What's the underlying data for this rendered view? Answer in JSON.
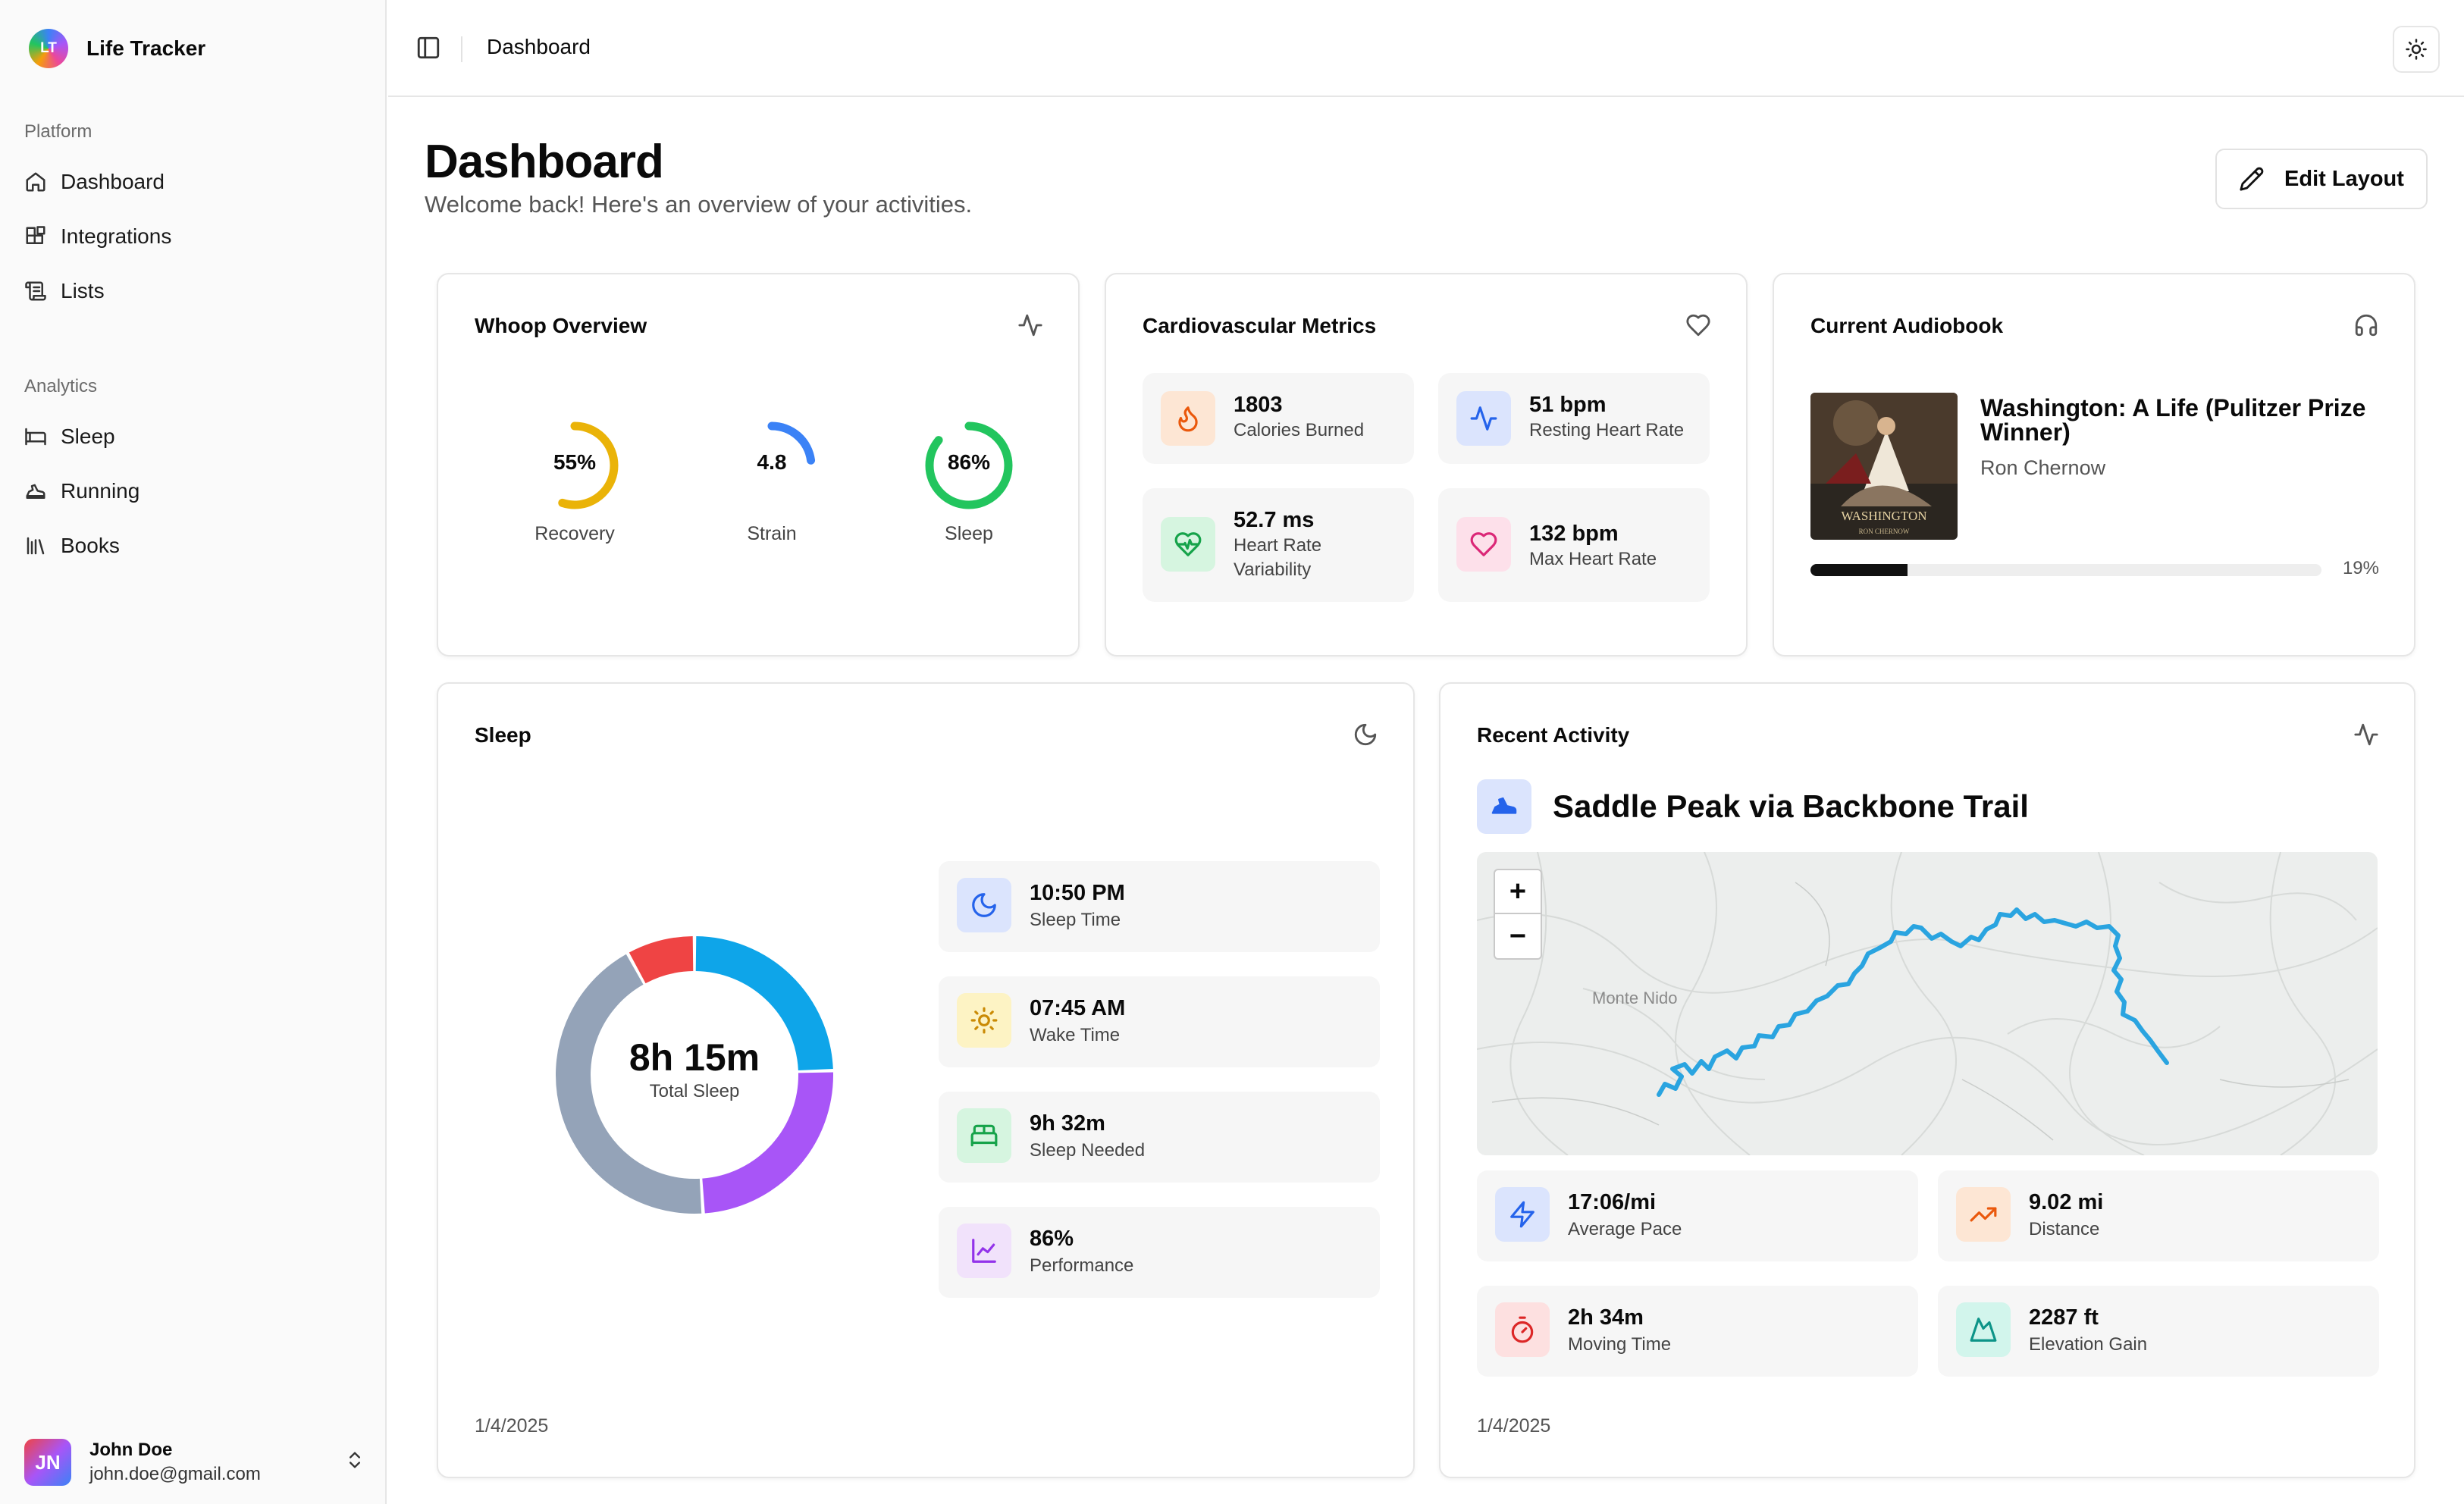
{
  "app": {
    "name": "Life Tracker",
    "logo_initials": "LT"
  },
  "sidebar": {
    "groups": [
      {
        "label": "Platform",
        "items": [
          {
            "label": "Dashboard",
            "icon": "home-icon"
          },
          {
            "label": "Integrations",
            "icon": "blocks-icon"
          },
          {
            "label": "Lists",
            "icon": "scroll-icon"
          }
        ]
      },
      {
        "label": "Analytics",
        "items": [
          {
            "label": "Sleep",
            "icon": "bed-icon"
          },
          {
            "label": "Running",
            "icon": "shoe-icon"
          },
          {
            "label": "Books",
            "icon": "library-icon"
          }
        ]
      }
    ],
    "user": {
      "initials": "JN",
      "name": "John Doe",
      "email": "john.doe@gmail.com"
    }
  },
  "topbar": {
    "breadcrumb": "Dashboard"
  },
  "header": {
    "title": "Dashboard",
    "subtitle": "Welcome back! Here's an overview of your activities.",
    "edit_label": "Edit Layout"
  },
  "whoop": {
    "title": "Whoop Overview",
    "rings": [
      {
        "value": "55%",
        "label": "Recovery",
        "fraction": 0.55,
        "color": "#eab308"
      },
      {
        "value": "4.8",
        "label": "Strain",
        "fraction": 0.229,
        "color": "#3b82f6"
      },
      {
        "value": "86%",
        "label": "Sleep",
        "fraction": 0.86,
        "color": "#22c55e"
      }
    ]
  },
  "cardio": {
    "title": "Cardiovascular Metrics",
    "metrics": [
      {
        "value": "1803",
        "label": "Calories Burned",
        "icon": "flame-icon",
        "bg": "#fde6d4",
        "color": "#ea580c"
      },
      {
        "value": "51 bpm",
        "label": "Resting Heart Rate",
        "icon": "activity-icon",
        "bg": "#dbe4fd",
        "color": "#2563eb"
      },
      {
        "value": "52.7 ms",
        "label_line1": "Heart Rate",
        "label_line2": "Variability",
        "icon": "heart-pulse-icon",
        "bg": "#d6f5e0",
        "color": "#16a34a"
      },
      {
        "value": "132 bpm",
        "label": "Max Heart Rate",
        "icon": "heart-icon",
        "bg": "#fde0ea",
        "color": "#db2777"
      }
    ]
  },
  "audiobook": {
    "title": "Current Audiobook",
    "book_title": "Washington: A Life (Pulitzer Prize Winner)",
    "author": "Ron Chernow",
    "progress": 0.19,
    "progress_label": "19%",
    "cover_text": "WASHINGTON",
    "cover_author": "RON CHERNOW"
  },
  "sleep": {
    "title": "Sleep",
    "total": "8h 15m",
    "total_label": "Total Sleep",
    "date": "1/4/2025",
    "stats": [
      {
        "value": "10:50 PM",
        "label": "Sleep Time",
        "icon": "moon-icon",
        "bg": "#dbe4fd",
        "color": "#2563eb"
      },
      {
        "value": "07:45 AM",
        "label": "Wake Time",
        "icon": "sun-icon",
        "bg": "#fdf3c4",
        "color": "#ca8a04"
      },
      {
        "value": "9h 32m",
        "label": "Sleep Needed",
        "icon": "bed-icon",
        "bg": "#d6f5e0",
        "color": "#16a34a"
      },
      {
        "value": "86%",
        "label": "Performance",
        "icon": "chart-line-icon",
        "bg": "#f1e2fb",
        "color": "#9333ea"
      }
    ],
    "stages": [
      {
        "fraction": 0.245,
        "color": "#0ea5e9"
      },
      {
        "fraction": 0.245,
        "color": "#a855f7"
      },
      {
        "fraction": 0.43,
        "color": "#94a3b8"
      },
      {
        "fraction": 0.08,
        "color": "#ef4444"
      }
    ]
  },
  "activity": {
    "title": "Recent Activity",
    "name": "Saddle Peak via Backbone Trail",
    "map_label": "Monte Nido",
    "zoom_in": "+",
    "zoom_out": "−",
    "date": "1/4/2025",
    "stats": [
      {
        "value": "17:06/mi",
        "label": "Average Pace",
        "icon": "zap-icon",
        "bg": "#dbe4fd",
        "color": "#2563eb"
      },
      {
        "value": "9.02 mi",
        "label": "Distance",
        "icon": "trending-up-icon",
        "bg": "#fde6d4",
        "color": "#ea580c"
      },
      {
        "value": "2h 34m",
        "label": "Moving Time",
        "icon": "timer-icon",
        "bg": "#fde0e0",
        "color": "#dc2626"
      },
      {
        "value": "2287 ft",
        "label": "Elevation Gain",
        "icon": "mountain-icon",
        "bg": "#d2f5ec",
        "color": "#0d9488"
      }
    ]
  }
}
